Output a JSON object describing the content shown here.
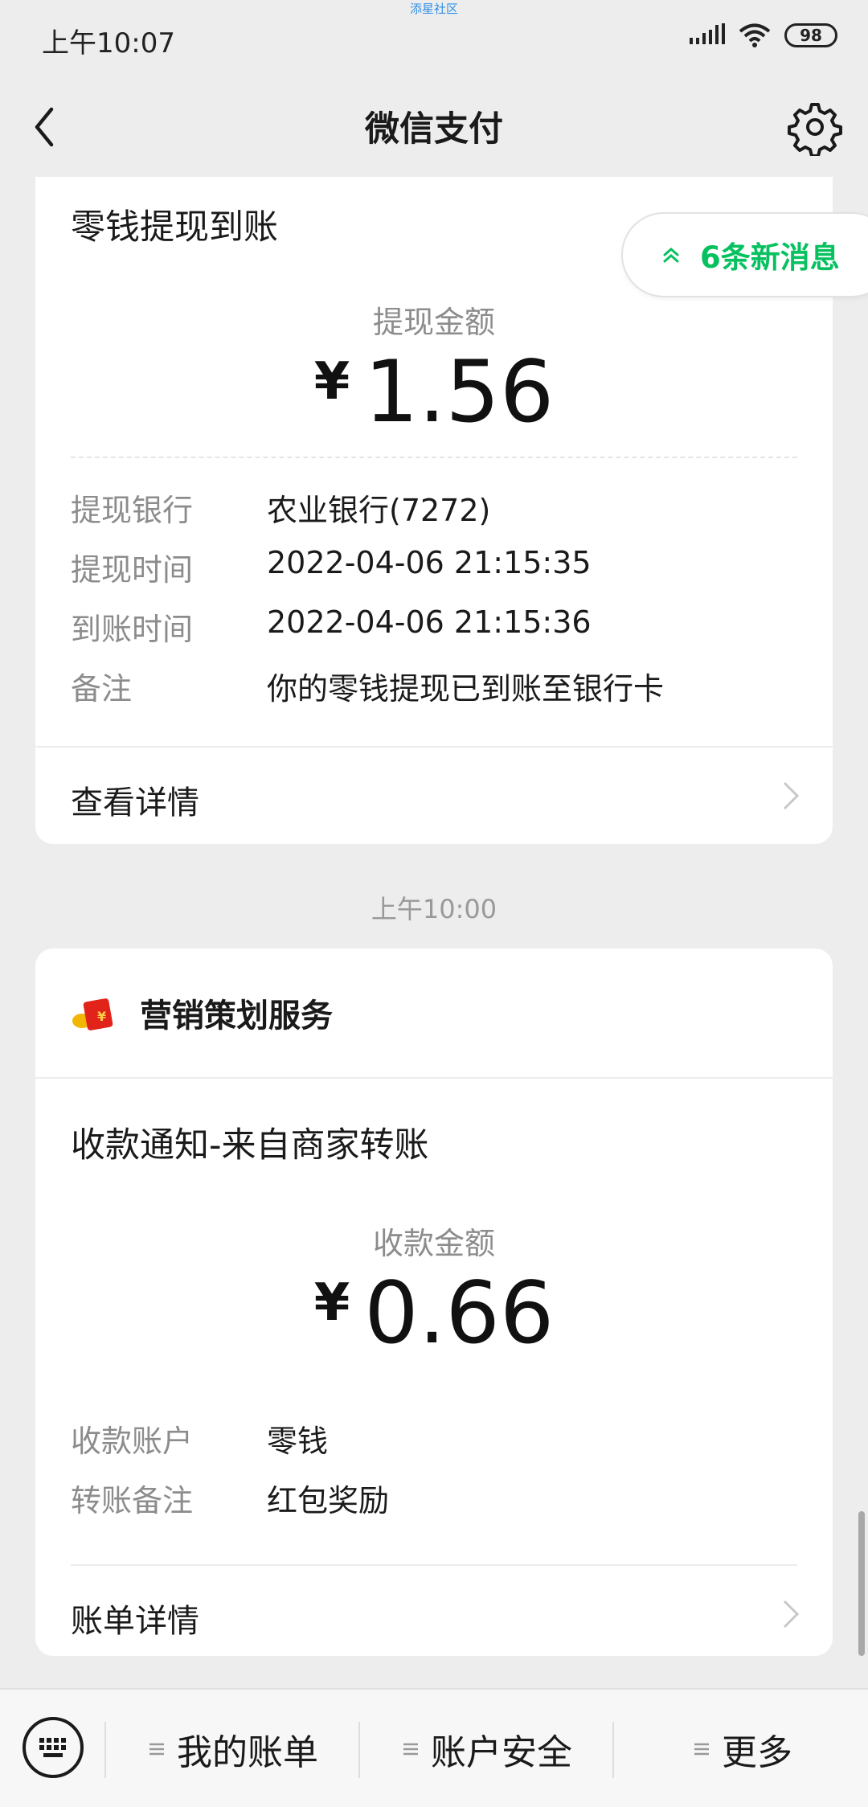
{
  "status_bar": {
    "time": "上午10:07",
    "watermark": "添星社区",
    "battery": "98"
  },
  "nav": {
    "title": "微信支付"
  },
  "new_messages": {
    "label": "6条新消息"
  },
  "card1": {
    "title": "零钱提现到账",
    "amount_label": "提现金额",
    "currency": "¥",
    "amount": "1.56",
    "rows": [
      {
        "key": "提现银行",
        "value": "农业银行(7272)"
      },
      {
        "key": "提现时间",
        "value": "2022-04-06 21:15:35"
      },
      {
        "key": "到账时间",
        "value": "2022-04-06 21:15:36"
      },
      {
        "key": "备注",
        "value": "你的零钱提现已到账至银行卡"
      }
    ],
    "link": "查看详情"
  },
  "time_separator": "上午10:00",
  "card2": {
    "merchant": "营销策划服务",
    "title": "收款通知-来自商家转账",
    "amount_label": "收款金额",
    "currency": "¥",
    "amount": "0.66",
    "rows": [
      {
        "key": "收款账户",
        "value": "零钱"
      },
      {
        "key": "转账备注",
        "value": "红包奖励"
      }
    ],
    "link": "账单详情"
  },
  "bottom_menu": {
    "items": [
      "我的账单",
      "账户安全",
      "更多"
    ]
  },
  "colors": {
    "accent": "#07c160",
    "background": "#ededed",
    "muted": "#8c8c8c"
  }
}
